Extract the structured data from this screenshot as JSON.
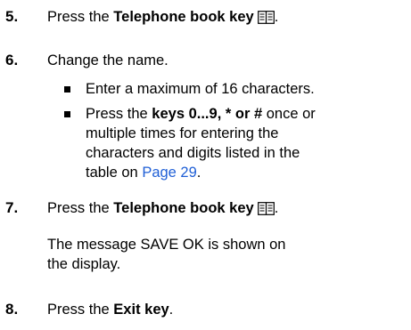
{
  "steps": [
    {
      "num": "5.",
      "pre": "Press the ",
      "bold": "Telephone book key",
      "post": "."
    },
    {
      "num": "6.",
      "text": "Change the name."
    },
    {
      "num": "7.",
      "pre": "Press the ",
      "bold": "Telephone book key",
      "post": "."
    },
    {
      "num": "8.",
      "pre": "Press the ",
      "bold": "Exit key",
      "post": "."
    }
  ],
  "bullets": [
    {
      "text": "Enter a maximum of 16 characters."
    },
    {
      "line1_pre": "Press the ",
      "line1_bold": "keys 0...9, * or #",
      "line1_post": " once or",
      "line2": "multiple times for entering the",
      "line3": "characters and digits listed in the",
      "line4_pre": "table on ",
      "line4_link": "Page 29",
      "line4_post": "."
    }
  ],
  "message": {
    "line1": "The message SAVE OK is shown on",
    "line2": "the display."
  },
  "icons": {
    "telephone_book": "telephone-book-icon"
  },
  "colors": {
    "text": "#000000",
    "link": "#1f5fd6"
  }
}
